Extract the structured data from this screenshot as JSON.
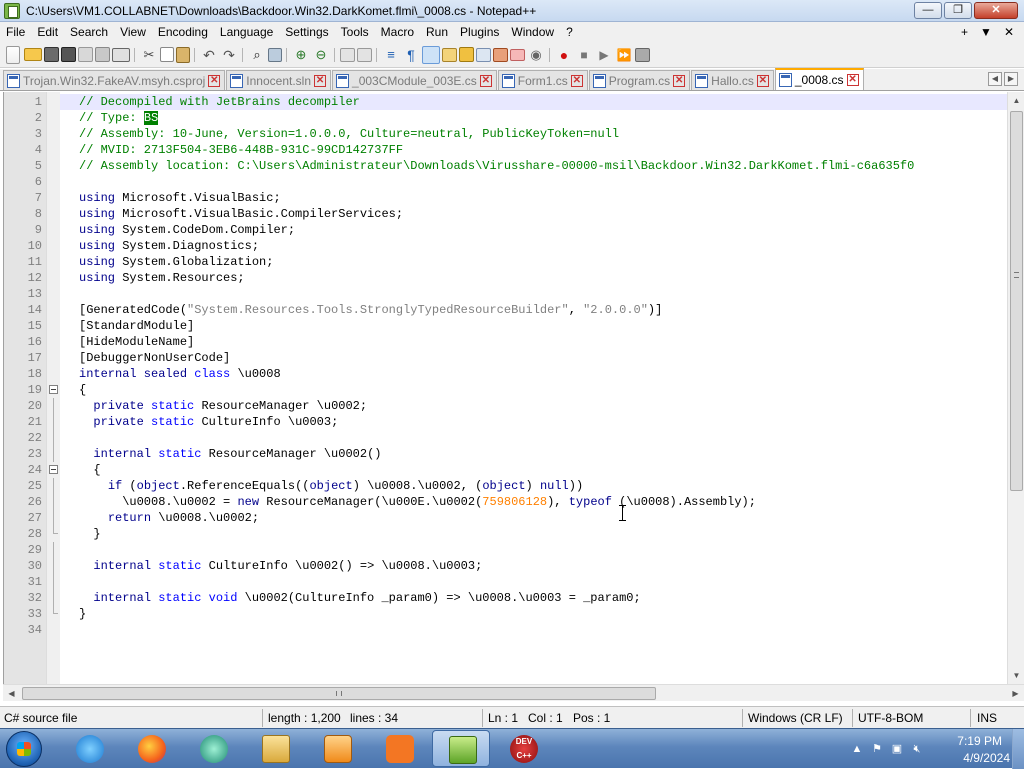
{
  "window": {
    "title": "C:\\Users\\VM1.COLLABNET\\Downloads\\Backdoor.Win32.DarkKomet.flmi\\_0008.cs - Notepad++",
    "minimize": "—",
    "maximize": "❐",
    "close": "✕"
  },
  "menu": {
    "items": [
      "File",
      "Edit",
      "Search",
      "View",
      "Encoding",
      "Language",
      "Settings",
      "Tools",
      "Macro",
      "Run",
      "Plugins",
      "Window",
      "?"
    ],
    "right_plus": "+",
    "right_dropdown": "▼",
    "right_close": "✕"
  },
  "toolbar": {
    "icons": [
      "new-file-icon",
      "open-file-icon",
      "save-icon",
      "save-all-icon",
      "close-icon",
      "close-all-icon",
      "print-icon",
      "cut-icon",
      "copy-icon",
      "paste-icon",
      "undo-icon",
      "redo-icon",
      "find-icon",
      "replace-icon",
      "zoom-in-icon",
      "zoom-out-icon",
      "sync-vertical-icon",
      "sync-horizontal-icon",
      "word-wrap-icon",
      "show-all-chars-icon",
      "indent-guide-icon",
      "language-xml-icon",
      "document-map-icon",
      "function-list-icon",
      "folder-as-workspace-icon",
      "monitoring-icon",
      "record-macro-icon",
      "stop-macro-icon",
      "play-macro-icon",
      "run-macro-multiple-icon",
      "save-macro-icon"
    ]
  },
  "tabs": [
    {
      "label": "Trojan.Win32.FakeAV.msyh.csproj",
      "active": false
    },
    {
      "label": "Innocent.sln",
      "active": false
    },
    {
      "label": "_003CModule_003E.cs",
      "active": false
    },
    {
      "label": "Form1.cs",
      "active": false
    },
    {
      "label": "Program.cs",
      "active": false
    },
    {
      "label": "Hallo.cs",
      "active": false
    },
    {
      "label": "_0008.cs",
      "active": true
    }
  ],
  "tab_nav": {
    "left": "◀",
    "right": "▶"
  },
  "editor": {
    "lines": [
      {
        "n": "1",
        "parts": [
          [
            "cm",
            "// Decompiled with JetBrains decompiler"
          ]
        ]
      },
      {
        "n": "2",
        "parts": [
          [
            "cm",
            "// Type: "
          ],
          [
            "hl",
            "BS"
          ]
        ]
      },
      {
        "n": "3",
        "parts": [
          [
            "cm",
            "// Assembly: 10-June, Version=1.0.0.0, Culture=neutral, PublicKeyToken=null"
          ]
        ]
      },
      {
        "n": "4",
        "parts": [
          [
            "cm",
            "// MVID: 2713F504-3EB6-448B-931C-99CD142737FF"
          ]
        ]
      },
      {
        "n": "5",
        "parts": [
          [
            "cm",
            "// Assembly location: C:\\Users\\Administrateur\\Downloads\\Virusshare-00000-msil\\Backdoor.Win32.DarkKomet.flmi-c6a635f0"
          ]
        ]
      },
      {
        "n": "6",
        "parts": []
      },
      {
        "n": "7",
        "parts": [
          [
            "kw",
            "using"
          ],
          [
            "p",
            " Microsoft.VisualBasic;"
          ]
        ]
      },
      {
        "n": "8",
        "parts": [
          [
            "kw",
            "using"
          ],
          [
            "p",
            " Microsoft.VisualBasic.CompilerServices;"
          ]
        ]
      },
      {
        "n": "9",
        "parts": [
          [
            "kw",
            "using"
          ],
          [
            "p",
            " System.CodeDom.Compiler;"
          ]
        ]
      },
      {
        "n": "10",
        "parts": [
          [
            "kw",
            "using"
          ],
          [
            "p",
            " System.Diagnostics;"
          ]
        ]
      },
      {
        "n": "11",
        "parts": [
          [
            "kw",
            "using"
          ],
          [
            "p",
            " System.Globalization;"
          ]
        ]
      },
      {
        "n": "12",
        "parts": [
          [
            "kw",
            "using"
          ],
          [
            "p",
            " System.Resources;"
          ]
        ]
      },
      {
        "n": "13",
        "parts": []
      },
      {
        "n": "14",
        "parts": [
          [
            "p",
            "[GeneratedCode("
          ],
          [
            "str",
            "\"System.Resources.Tools.StronglyTypedResourceBuilder\""
          ],
          [
            "p",
            ", "
          ],
          [
            "str",
            "\"2.0.0.0\""
          ],
          [
            "p",
            ")]"
          ]
        ]
      },
      {
        "n": "15",
        "parts": [
          [
            "p",
            "[StandardModule]"
          ]
        ]
      },
      {
        "n": "16",
        "parts": [
          [
            "p",
            "[HideModuleName]"
          ]
        ]
      },
      {
        "n": "17",
        "parts": [
          [
            "p",
            "[DebuggerNonUserCode]"
          ]
        ]
      },
      {
        "n": "18",
        "parts": [
          [
            "kw",
            "internal sealed"
          ],
          [
            "p",
            " "
          ],
          [
            "kw2",
            "class"
          ],
          [
            "p",
            " \\u0008"
          ]
        ]
      },
      {
        "n": "19",
        "parts": [
          [
            "p",
            "{"
          ]
        ],
        "fold": "open"
      },
      {
        "n": "20",
        "parts": [
          [
            "p",
            "  "
          ],
          [
            "kw",
            "private"
          ],
          [
            "p",
            " "
          ],
          [
            "kw2",
            "static"
          ],
          [
            "p",
            " ResourceManager \\u0002;"
          ]
        ],
        "fold": "line"
      },
      {
        "n": "21",
        "parts": [
          [
            "p",
            "  "
          ],
          [
            "kw",
            "private"
          ],
          [
            "p",
            " "
          ],
          [
            "kw2",
            "static"
          ],
          [
            "p",
            " CultureInfo \\u0003;"
          ]
        ],
        "fold": "line"
      },
      {
        "n": "22",
        "parts": [],
        "fold": "line"
      },
      {
        "n": "23",
        "parts": [
          [
            "p",
            "  "
          ],
          [
            "kw",
            "internal"
          ],
          [
            "p",
            " "
          ],
          [
            "kw2",
            "static"
          ],
          [
            "p",
            " ResourceManager \\u0002()"
          ]
        ],
        "fold": "line"
      },
      {
        "n": "24",
        "parts": [
          [
            "p",
            "  {"
          ]
        ],
        "fold": "open"
      },
      {
        "n": "25",
        "parts": [
          [
            "p",
            "    "
          ],
          [
            "kw",
            "if"
          ],
          [
            "p",
            " ("
          ],
          [
            "kw",
            "object"
          ],
          [
            "p",
            ".ReferenceEquals(("
          ],
          [
            "kw",
            "object"
          ],
          [
            "p",
            ") \\u0008.\\u0002, ("
          ],
          [
            "kw",
            "object"
          ],
          [
            "p",
            ") "
          ],
          [
            "kw",
            "null"
          ],
          [
            "p",
            "))"
          ]
        ],
        "fold": "line"
      },
      {
        "n": "26",
        "parts": [
          [
            "p",
            "      \\u0008.\\u0002 = "
          ],
          [
            "kw",
            "new"
          ],
          [
            "p",
            " ResourceManager(\\u000E.\\u0002("
          ],
          [
            "num",
            "759806128"
          ],
          [
            "p",
            "), "
          ],
          [
            "kw",
            "typeof"
          ],
          [
            "p",
            " (\\u0008).Assembly);"
          ]
        ],
        "fold": "line"
      },
      {
        "n": "27",
        "parts": [
          [
            "p",
            "    "
          ],
          [
            "kw",
            "return"
          ],
          [
            "p",
            " \\u0008.\\u0002;"
          ]
        ],
        "fold": "line"
      },
      {
        "n": "28",
        "parts": [
          [
            "p",
            "  }"
          ]
        ],
        "fold": "end"
      },
      {
        "n": "29",
        "parts": [],
        "fold": "line"
      },
      {
        "n": "30",
        "parts": [
          [
            "p",
            "  "
          ],
          [
            "kw",
            "internal"
          ],
          [
            "p",
            " "
          ],
          [
            "kw2",
            "static"
          ],
          [
            "p",
            " CultureInfo \\u0002() => \\u0008.\\u0003;"
          ]
        ],
        "fold": "line"
      },
      {
        "n": "31",
        "parts": [],
        "fold": "line"
      },
      {
        "n": "32",
        "parts": [
          [
            "p",
            "  "
          ],
          [
            "kw",
            "internal"
          ],
          [
            "p",
            " "
          ],
          [
            "kw2",
            "static void"
          ],
          [
            "p",
            " \\u0002(CultureInfo _param0) => \\u0008.\\u0003 = _param0;"
          ]
        ],
        "fold": "line"
      },
      {
        "n": "33",
        "parts": [
          [
            "p",
            "}"
          ]
        ],
        "fold": "end"
      },
      {
        "n": "34",
        "parts": []
      }
    ]
  },
  "statusbar": {
    "file_type": "C# source file",
    "length": "length : 1,200",
    "lines": "lines : 34",
    "ln": "Ln : 1",
    "col": "Col : 1",
    "pos": "Pos : 1",
    "eol": "Windows (CR LF)",
    "encoding": "UTF-8-BOM",
    "mode": "INS"
  },
  "taskbar": {
    "apps": [
      "internet-explorer",
      "firefox",
      "cortana-like-app",
      "file-explorer",
      "media-player",
      "xampp",
      "notepad-plus-plus",
      "dev-cpp"
    ],
    "dev_cpp_label": "DEV C++",
    "time": "7:19 PM",
    "date": "4/9/2024"
  },
  "colors": {
    "comment": "#008000",
    "keyword": "#00008b",
    "keyword2": "#0000ff",
    "string": "#808080",
    "number": "#ff8000",
    "current_line": "#e8e8ff",
    "active_tab_border": "#ffaa00"
  }
}
